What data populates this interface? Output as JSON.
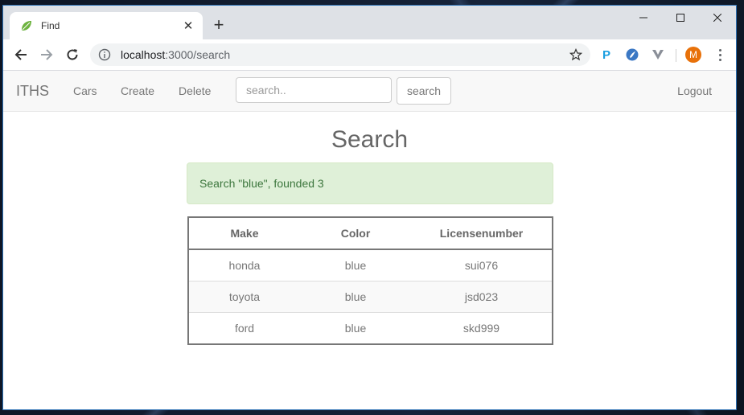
{
  "browser": {
    "tab": {
      "title": "Find",
      "favicon": "spring-leaf-icon"
    },
    "new_tab_label": "+",
    "window_controls": [
      "minimize-icon",
      "maximize-icon",
      "close-icon"
    ],
    "address": {
      "host": "localhost",
      "rest": ":3000/search"
    },
    "extensions": [
      {
        "name": "p-extension-icon",
        "label": "P",
        "color": "#1a9ee0"
      },
      {
        "name": "circle-extension-icon",
        "color": "#3b78c4"
      },
      {
        "name": "v-extension-icon",
        "color": "#8a8f98"
      }
    ],
    "profile_initial": "M",
    "profile_color": "#e8710a"
  },
  "navbar": {
    "brand": "ITHS",
    "links": [
      "Cars",
      "Create",
      "Delete"
    ],
    "search": {
      "placeholder": "search..",
      "value": ""
    },
    "search_button": "search",
    "logout": "Logout"
  },
  "main": {
    "title": "Search",
    "alert": "Search \"blue\", founded 3",
    "alert_color": "#dff0d8",
    "table": {
      "headers": [
        "Make",
        "Color",
        "Licensenumber"
      ],
      "rows": [
        [
          "honda",
          "blue",
          "sui076"
        ],
        [
          "toyota",
          "blue",
          "jsd023"
        ],
        [
          "ford",
          "blue",
          "skd999"
        ]
      ]
    }
  }
}
